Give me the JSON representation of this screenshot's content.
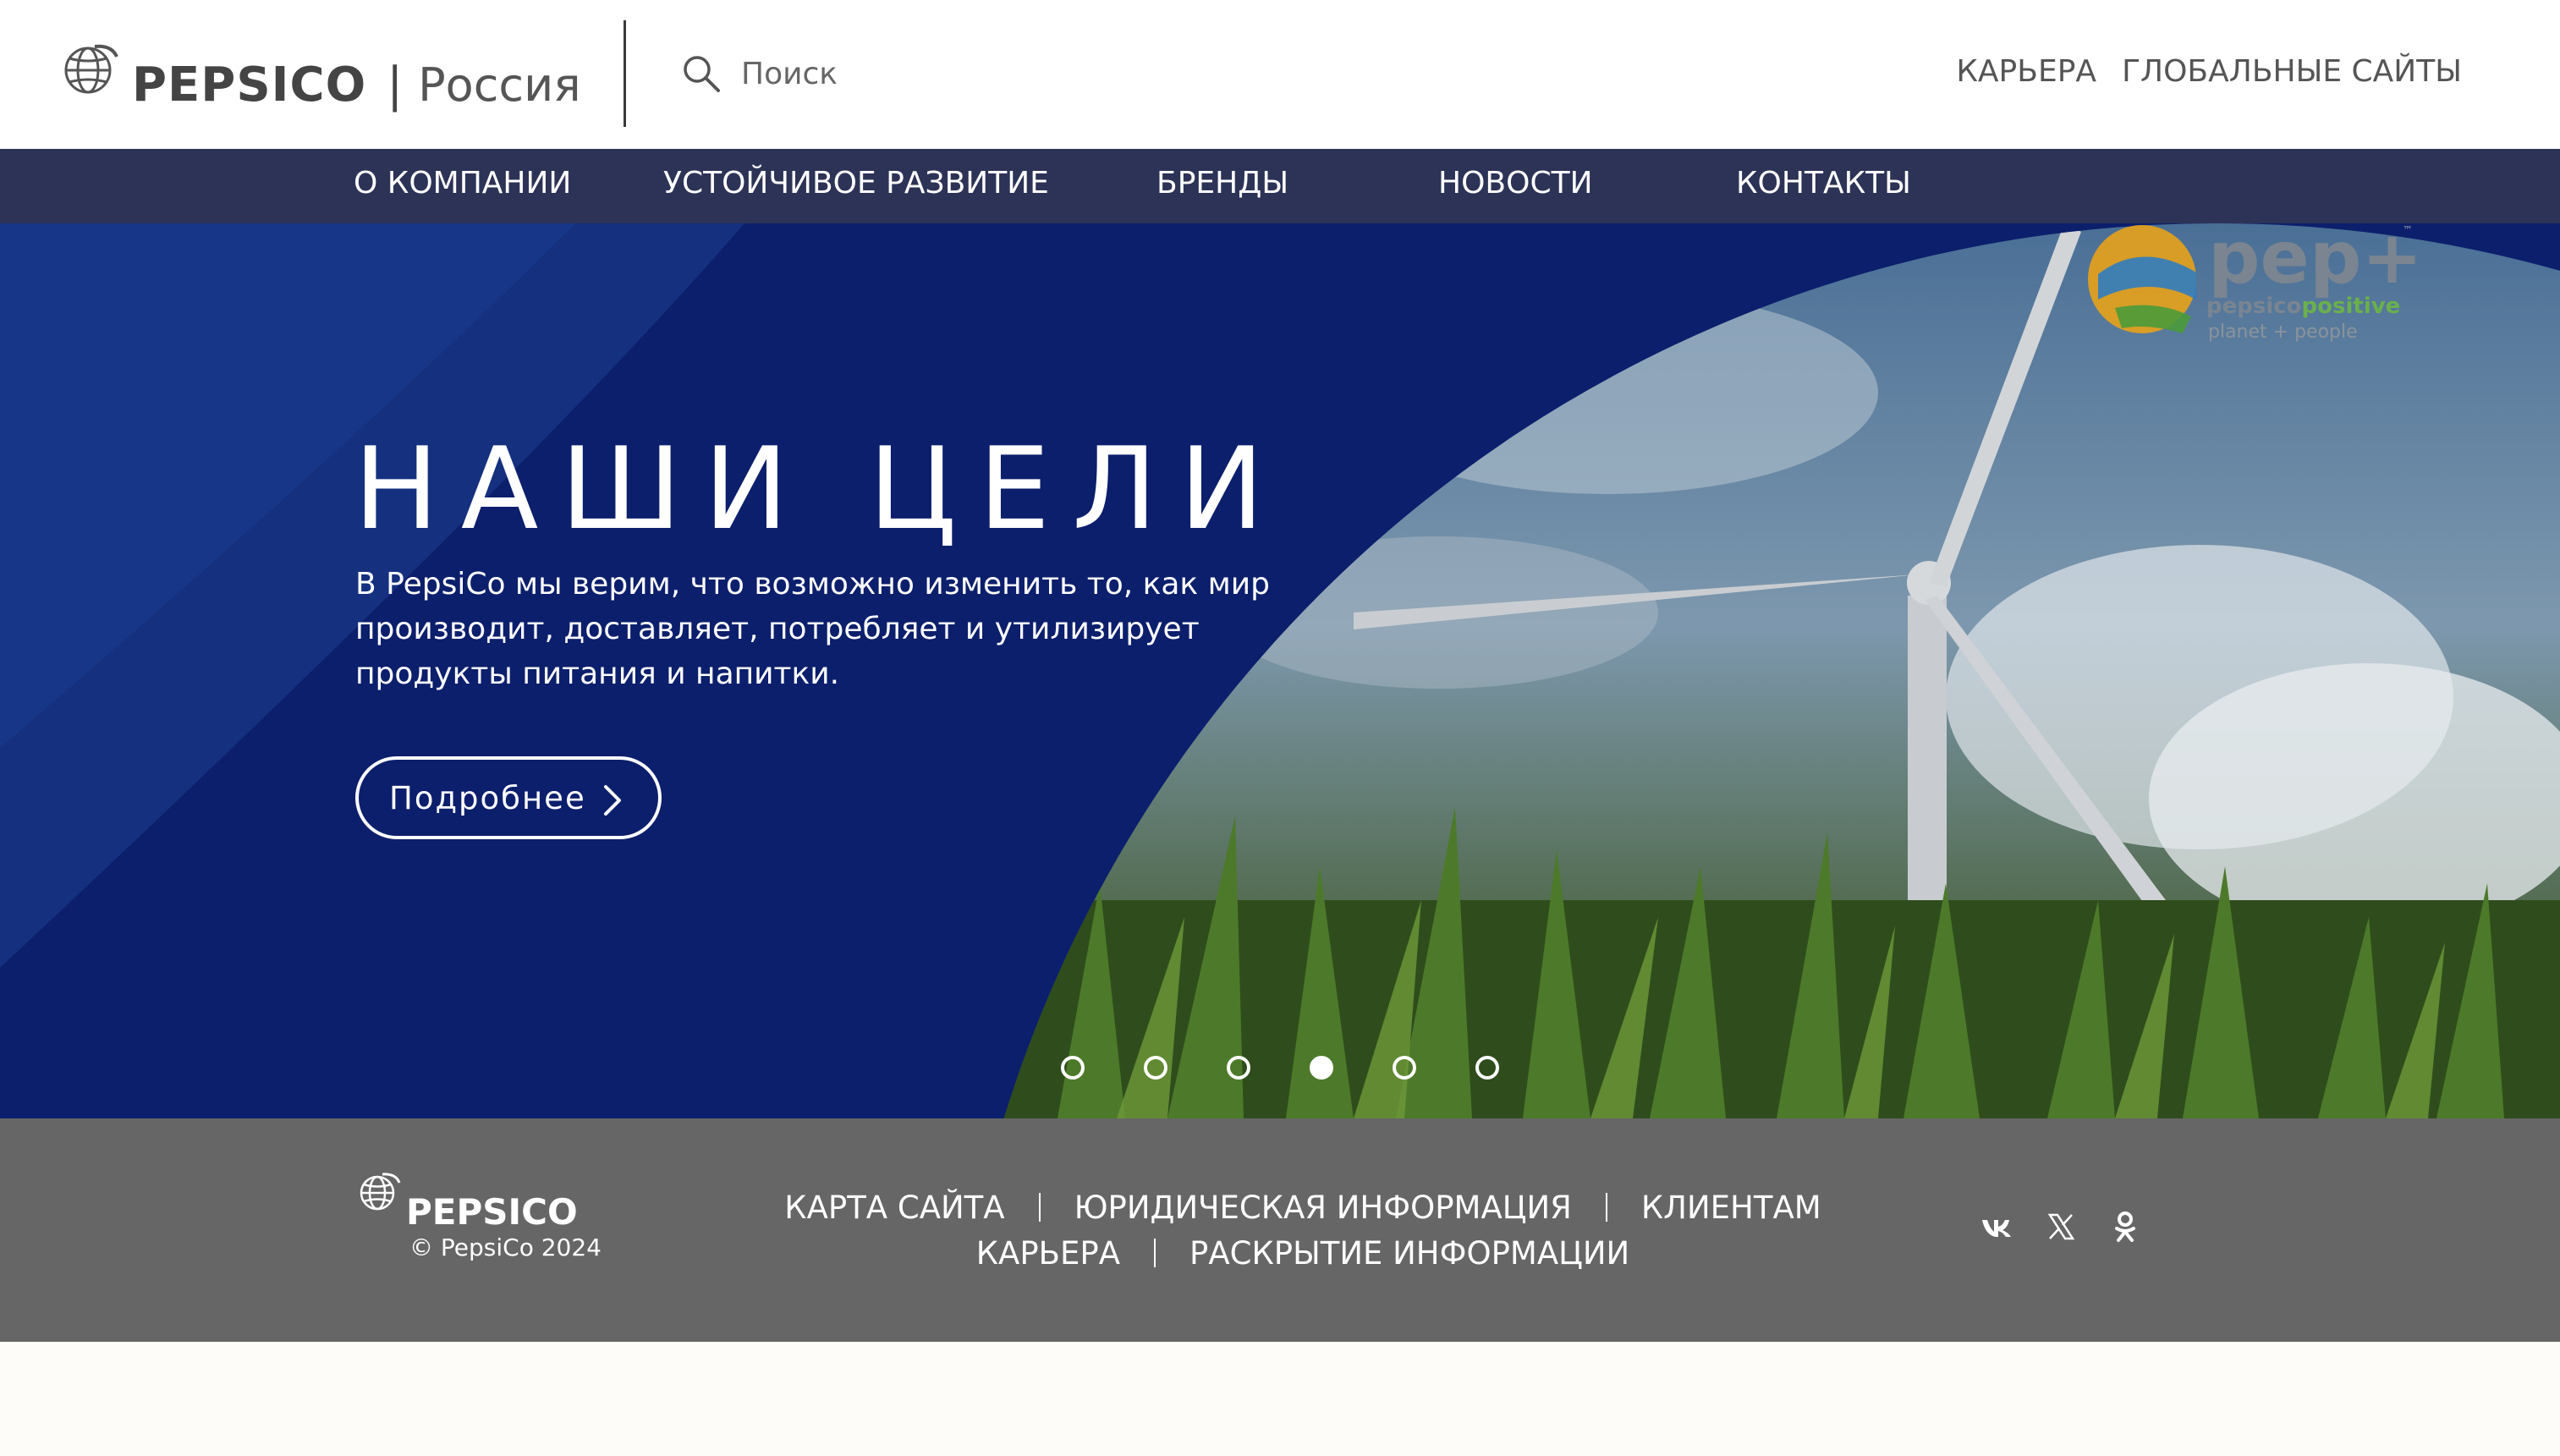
{
  "header": {
    "brand": "PEPSICO",
    "separator": "|",
    "region": "Россия",
    "search_placeholder": "Поиск",
    "util_links": [
      "КАРЬЕРА",
      "ГЛОБАЛЬНЫЕ САЙТЫ"
    ]
  },
  "nav": {
    "items": [
      "О КОМПАНИИ",
      "УСТОЙЧИВОЕ РАЗВИТИЕ",
      "БРЕНДЫ",
      "НОВОСТИ",
      "КОНТАКТЫ"
    ]
  },
  "hero": {
    "title": "НАШИ ЦЕЛИ",
    "text": "В PepsiCo мы верим, что возможно изменить то, как мир производит, доставляет, потребляет и утилизирует продукты питания и напитки.",
    "button_label": "Подробнее",
    "badge": {
      "wordmark": "pep+",
      "line1_a": "pepsico",
      "line1_b": "positive",
      "line2": "planet + people",
      "tm": "™"
    },
    "slides": {
      "count": 6,
      "active_index": 3
    }
  },
  "footer": {
    "brand": "PEPSICO",
    "copyright": "© PepsiCo 2024",
    "links_row1": [
      "КАРТА САЙТА",
      "ЮРИДИЧЕСКАЯ ИНФОРМАЦИЯ",
      "КЛИЕНТАМ"
    ],
    "links_row2": [
      "КАРЬЕРА",
      "РАСКРЫТИЕ ИНФОРМАЦИИ"
    ],
    "social": [
      "vk-icon",
      "x-icon",
      "odnoklassniki-icon"
    ]
  },
  "colors": {
    "nav_bg": "#2d3356",
    "hero_bg": "#0a1e6b",
    "footer_bg": "#666666",
    "accent_green": "#6ab04c"
  }
}
